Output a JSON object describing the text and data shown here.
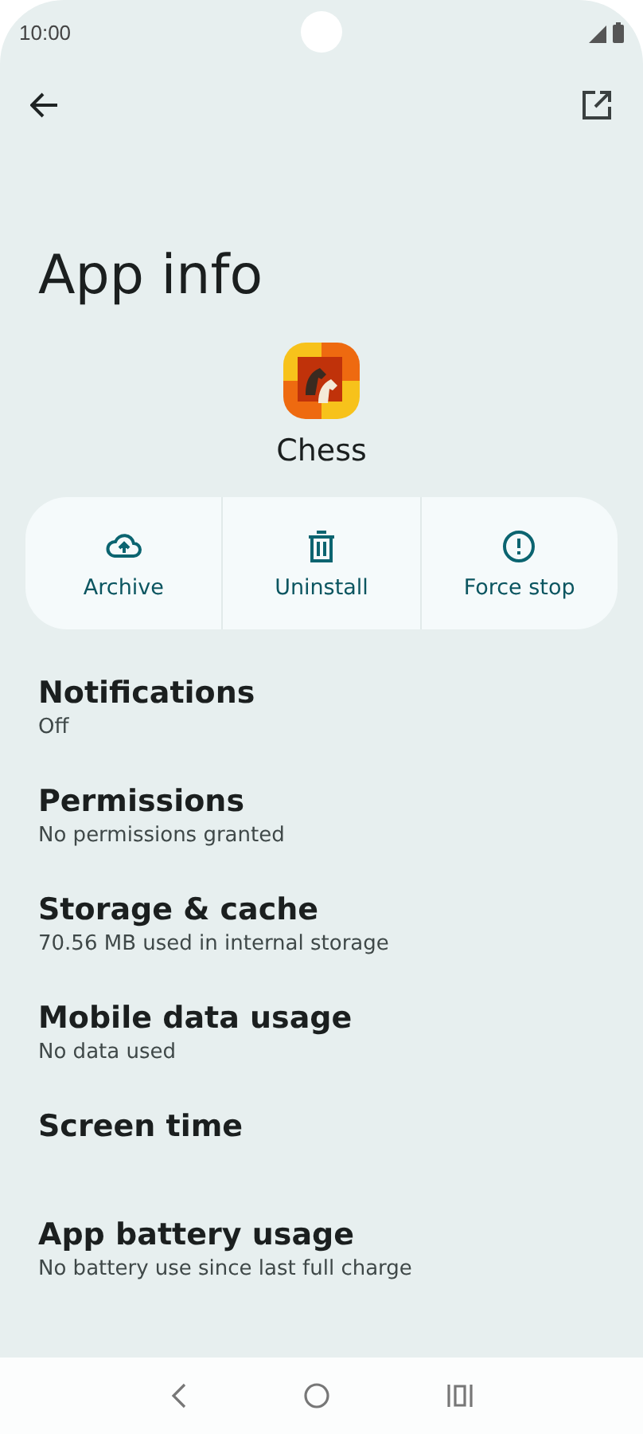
{
  "status_bar": {
    "time": "10:00"
  },
  "title": "App info",
  "app": {
    "name": "Chess"
  },
  "actions": [
    {
      "kind": "archive",
      "label": "Archive"
    },
    {
      "kind": "uninstall",
      "label": "Uninstall"
    },
    {
      "kind": "force-stop",
      "label": "Force stop"
    }
  ],
  "settings": [
    {
      "title": "Notifications",
      "subtitle": "Off"
    },
    {
      "title": "Permissions",
      "subtitle": "No permissions granted"
    },
    {
      "title": "Storage & cache",
      "subtitle": "70.56 MB used in internal storage"
    },
    {
      "title": "Mobile data usage",
      "subtitle": "No data used"
    },
    {
      "title": "Screen time"
    },
    {
      "title": "App battery usage",
      "subtitle": "No battery use since last full charge"
    }
  ]
}
